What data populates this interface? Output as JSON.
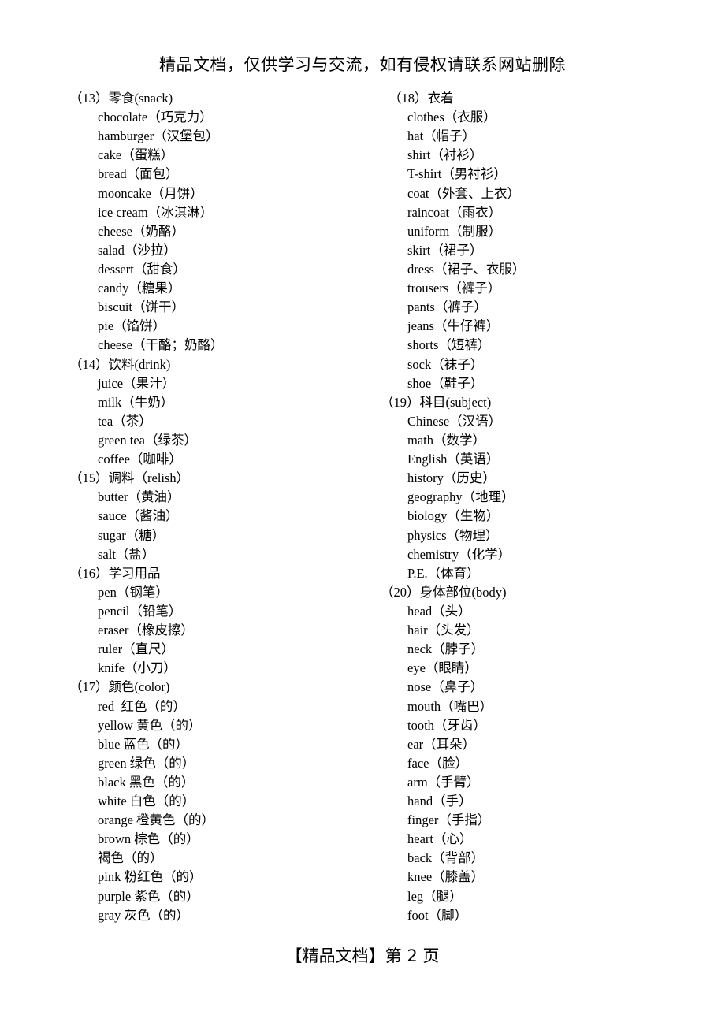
{
  "header": {
    "watermark": "精品文档，仅供学习与交流，如有侵权请联系网站删除"
  },
  "footer": {
    "page_label": "【精品文档】第 2 页"
  },
  "left_column": {
    "sections": [
      {
        "heading": "（13）零食(snack)",
        "items": [
          "chocolate（巧克力）",
          "hamburger（汉堡包）",
          "cake（蛋糕）",
          "bread（面包）",
          "mooncake（月饼）",
          "ice cream（冰淇淋）",
          "cheese（奶酪）",
          "salad（沙拉）",
          "dessert（甜食）",
          "candy（糖果）",
          "biscuit（饼干）",
          "pie（馅饼）",
          "cheese（干酪；奶酪）"
        ]
      },
      {
        "heading": "（14）饮料(drink)",
        "items": [
          "juice（果汁）",
          "milk（牛奶）",
          "tea（茶）",
          "green tea（绿茶）",
          "coffee（咖啡）"
        ]
      },
      {
        "heading": "（15）调料（relish）",
        "items": [
          "butter（黄油）",
          "sauce（酱油）",
          "sugar（糖）",
          "salt（盐）"
        ]
      },
      {
        "heading": "（16）学习用品",
        "items": [
          "pen（钢笔）",
          "pencil（铅笔）",
          "eraser（橡皮擦）",
          "ruler（直尺）",
          "knife（小刀）"
        ]
      },
      {
        "heading": "（17）颜色(color)",
        "items": [
          "red  红色（的）",
          "yellow 黄色（的）",
          "blue 蓝色（的）",
          "green 绿色（的）",
          "black 黑色（的）",
          "white 白色（的）",
          "orange 橙黄色（的）",
          "brown 棕色（的）",
          "褐色（的）",
          "pink 粉红色（的）",
          "purple 紫色（的）",
          "gray 灰色（的）"
        ]
      }
    ]
  },
  "right_column": {
    "sections": [
      {
        "heading": "（18）衣着",
        "items": [
          "clothes（衣服）",
          "hat（帽子）",
          "shirt（衬衫）",
          "T-shirt（男衬衫）",
          "coat（外套、上衣）",
          "raincoat（雨衣）",
          "uniform（制服）",
          "skirt（裙子）",
          "dress（裙子、衣服）",
          "trousers（裤子）",
          "pants（裤子）",
          "jeans（牛仔裤）",
          "shorts（短裤）",
          "sock（袜子）",
          "shoe（鞋子）"
        ]
      },
      {
        "heading": "（19）科目(subject)",
        "items": [
          "Chinese（汉语）",
          "math（数学）",
          "English（英语）",
          "history（历史）",
          "geography（地理）",
          "biology（生物）",
          "physics（物理）",
          "chemistry（化学）",
          "P.E.（体育）"
        ]
      },
      {
        "heading": "（20）身体部位(body)",
        "items": [
          "head（头）",
          "hair（头发）",
          "neck（脖子）",
          "eye（眼睛）",
          "nose（鼻子）",
          "mouth（嘴巴）",
          "tooth（牙齿）",
          "ear（耳朵）",
          "face（脸）",
          "arm（手臂）",
          "hand（手）",
          "finger（手指）",
          "heart（心）",
          "back（背部）",
          "knee（膝盖）",
          "leg（腿）",
          "foot（脚）"
        ]
      }
    ]
  }
}
